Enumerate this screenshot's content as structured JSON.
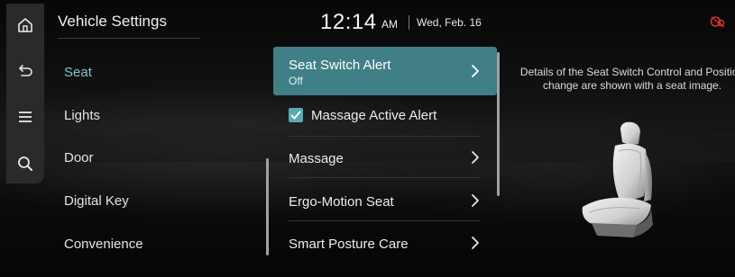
{
  "header": {
    "title": "Vehicle Settings",
    "time": "12:14",
    "ampm": "AM",
    "date": "Wed, Feb. 16"
  },
  "rail": {
    "icons": [
      "home-icon",
      "back-icon",
      "menu-icon",
      "search-icon"
    ]
  },
  "categories": [
    {
      "label": "Seat",
      "active": true
    },
    {
      "label": "Lights",
      "active": false
    },
    {
      "label": "Door",
      "active": false
    },
    {
      "label": "Digital Key",
      "active": false
    },
    {
      "label": "Convenience",
      "active": false
    }
  ],
  "options": {
    "seat_switch_alert": {
      "label": "Seat Switch Alert",
      "value": "Off"
    },
    "massage_active_alert": {
      "label": "Massage Active Alert",
      "checked": true
    },
    "massage": {
      "label": "Massage"
    },
    "ergo_motion_seat": {
      "label": "Ergo-Motion Seat"
    },
    "smart_posture_care": {
      "label": "Smart Posture Care"
    }
  },
  "details": {
    "text": "Details of the Seat Switch Control and Position change are shown with a seat image."
  },
  "colors": {
    "accent": "#3f7f85",
    "active_text": "#7fc3c9",
    "status_icon": "#d0322e"
  }
}
